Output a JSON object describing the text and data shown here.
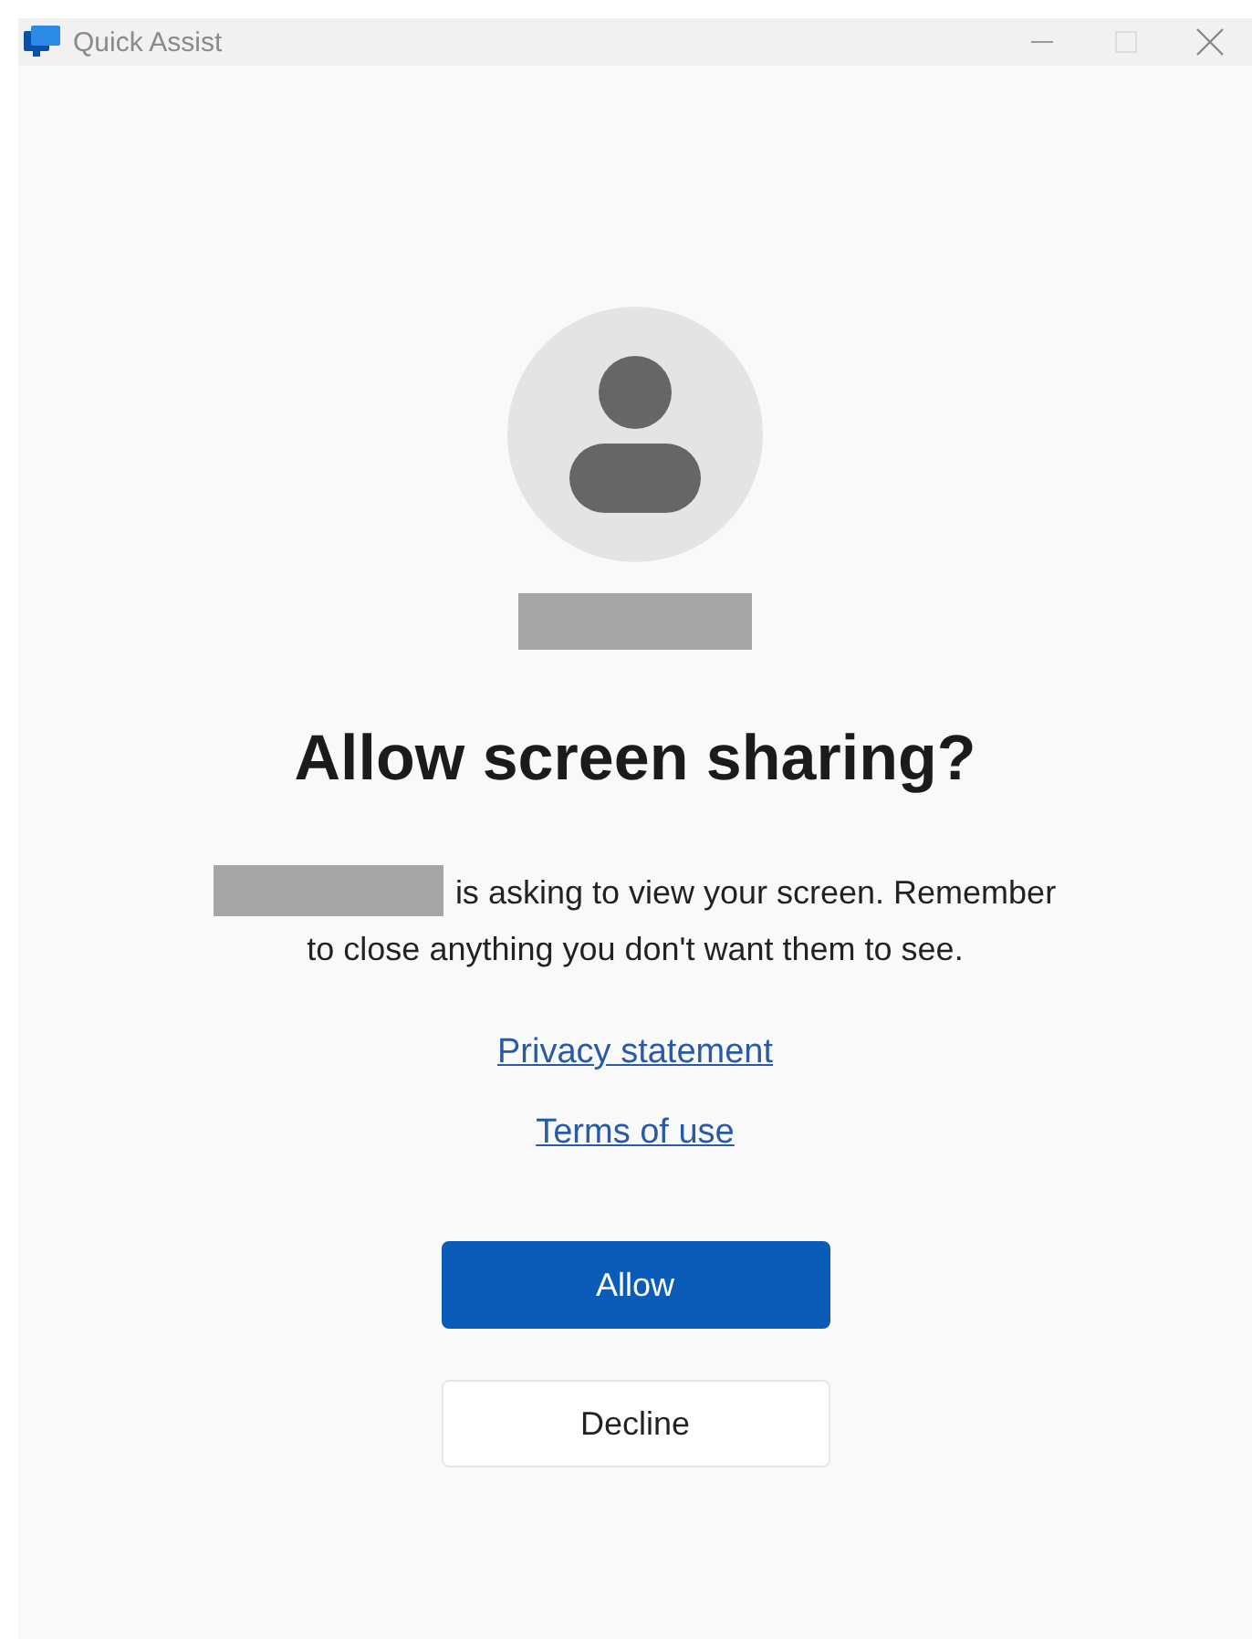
{
  "window": {
    "title": "Quick Assist"
  },
  "dialog": {
    "heading": "Allow screen sharing?",
    "message": "is asking to view your screen. Remember to close anything you don't want them to see.",
    "links": [
      "Privacy statement",
      "Terms of use"
    ],
    "buttons": [
      {
        "label": "Allow",
        "kind": "primary"
      },
      {
        "label": "Decline",
        "kind": "secondary"
      }
    ]
  }
}
